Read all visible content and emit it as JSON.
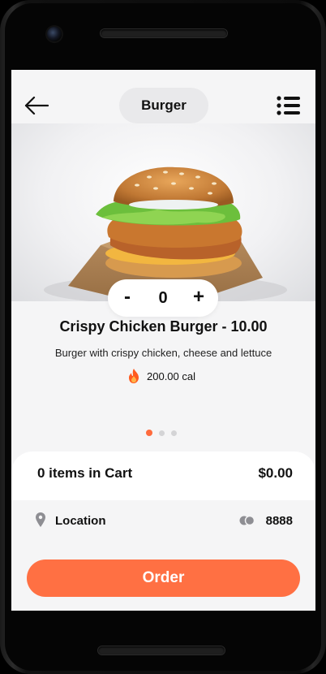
{
  "app": {
    "title": "Burger"
  },
  "header": {
    "back_icon": "arrow-left-icon",
    "menu_icon": "list-menu-icon"
  },
  "product": {
    "image_alt_icon": "crispy-chicken-burger-image",
    "quantity": "0",
    "minus_label": "-",
    "plus_label": "+",
    "name": "Crispy Chicken Burger - 10.00",
    "description": "Burger with crispy chicken, cheese and lettuce",
    "calories": "200.00 cal",
    "calorie_icon": "fire-icon"
  },
  "carousel": {
    "total_slides": 3,
    "active_index": 0
  },
  "cart": {
    "items_label": "0 items in Cart",
    "total": "$0.00"
  },
  "location": {
    "label": "Location",
    "icon": "map-pin-icon",
    "points_icon": "coins-icon",
    "points": "8888"
  },
  "order": {
    "label": "Order"
  },
  "colors": {
    "accent": "#ff7043",
    "active_dot": "#ff6b3d",
    "inactive_dot": "#d4d4d6",
    "screen_bg": "#f5f5f6"
  }
}
